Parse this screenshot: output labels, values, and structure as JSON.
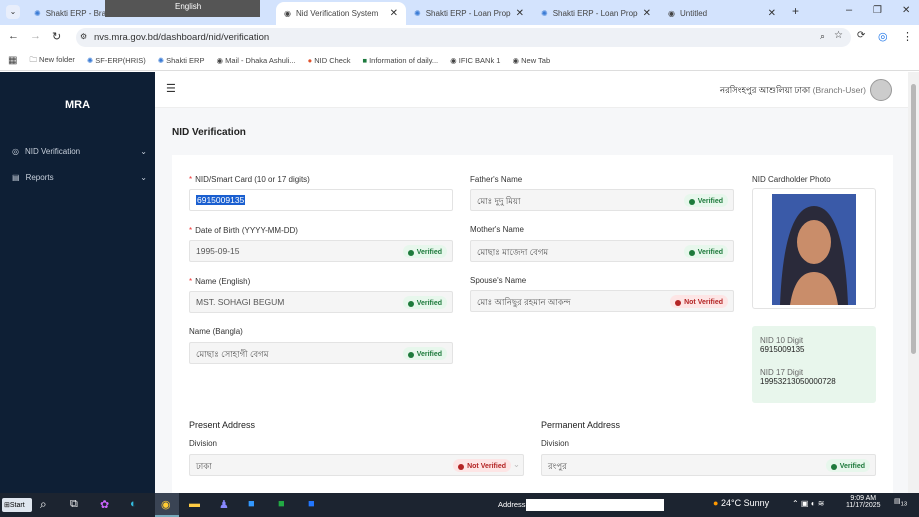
{
  "browser": {
    "tabs": [
      {
        "label": "Shakti ERP - Branch",
        "active": false
      },
      {
        "label": "Nid Verification System",
        "active": true
      },
      {
        "label": "Shakti ERP - Loan Proposal",
        "active": false
      },
      {
        "label": "Shakti ERP - Loan Proposal",
        "active": false
      },
      {
        "label": "Untitled",
        "active": false
      }
    ],
    "overlay_text": "English",
    "url": "nvs.mra.gov.bd/dashboard/nid/verification",
    "bookmarks": [
      "New folder",
      "SF-ERP(HRIS)",
      "Shakti ERP",
      "Mail - Dhaka Ashuli...",
      "NID Check",
      "Information of daily...",
      "IFIC BANk 1",
      "New Tab"
    ]
  },
  "sidebar": {
    "logo": "MRA",
    "items": [
      {
        "label": "NID Verification"
      },
      {
        "label": "Reports"
      }
    ]
  },
  "header": {
    "user": "নরসিংহপুর আশুলিয়া ঢাকা",
    "role": "(Branch-User)"
  },
  "page": {
    "title": "NID Verification"
  },
  "form": {
    "nid": {
      "label": "NID/Smart Card (10 or 17 digits)",
      "value": "6915009135"
    },
    "dob": {
      "label": "Date of Birth (YYYY-MM-DD)",
      "value": "1995-09-15",
      "status": "Verified"
    },
    "name_en": {
      "label": "Name (English)",
      "value": "MST. SOHAGI BEGUM",
      "status": "Verified"
    },
    "name_bn": {
      "label": "Name (Bangla)",
      "value": "মোছাঃ সোহাগী বেগম",
      "status": "Verified"
    },
    "father": {
      "label": "Father's Name",
      "value": "মোঃ দুদু মিয়া",
      "status": "Verified"
    },
    "mother": {
      "label": "Mother's Name",
      "value": "মোছাঃ মাজেদা বেগম",
      "status": "Verified"
    },
    "spouse": {
      "label": "Spouse's Name",
      "value": "মোঃ আনিছুর রহমান আকন্দ",
      "status": "Not Verified"
    },
    "photo_label": "NID Cardholder Photo",
    "nid10_label": "NID 10 Digit",
    "nid10": "6915009135",
    "nid17_label": "NID 17 Digit",
    "nid17": "19953213050000728",
    "present": {
      "title": "Present Address",
      "division_label": "Division",
      "division": "ঢাকা",
      "status": "Not Verified"
    },
    "permanent": {
      "title": "Permanent Address",
      "division_label": "Division",
      "division": "রংপুর",
      "status": "Verified"
    }
  },
  "taskbar": {
    "start": "Start",
    "address_label": "Address",
    "weather": "24°C  Sunny",
    "time": "9:09 AM",
    "date": "11/17/2025",
    "notif": "13"
  },
  "colors": {
    "sidebar": "#0e1f35",
    "verified": "#1e7a3c",
    "not_verified": "#b42424"
  }
}
